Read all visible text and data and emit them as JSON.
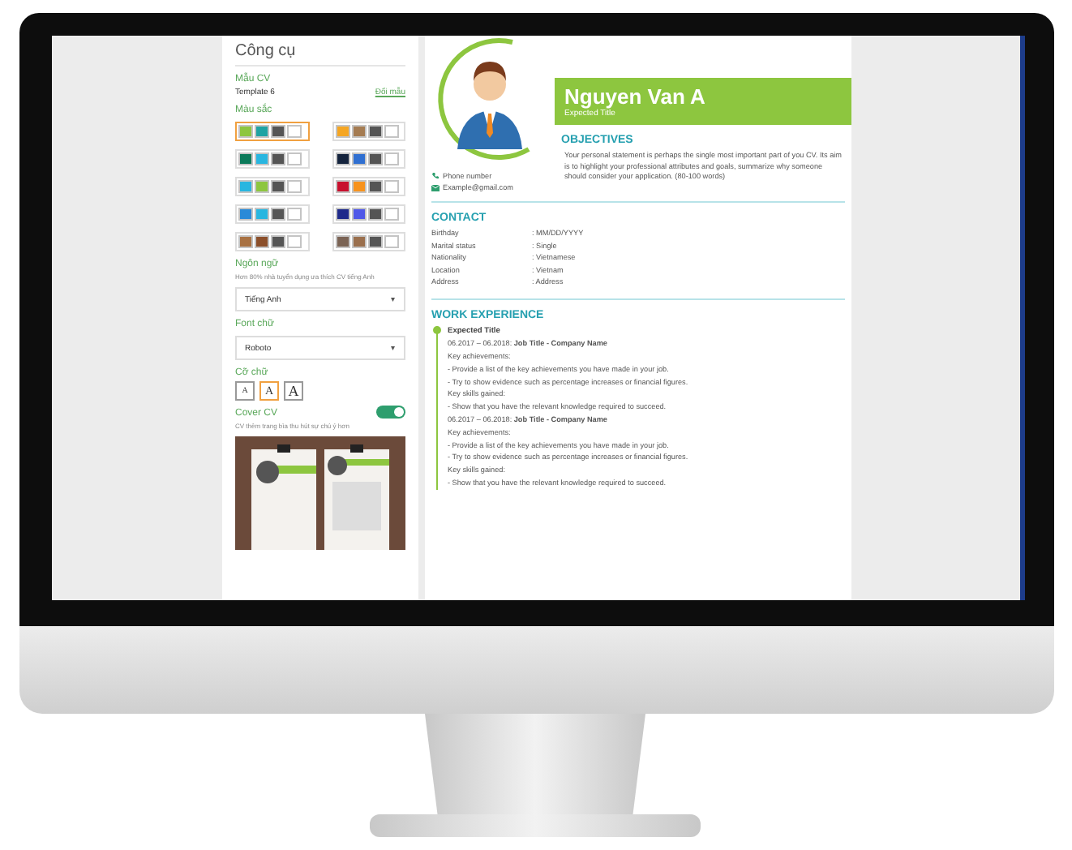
{
  "sidebar": {
    "title": "Công cụ",
    "template": {
      "label": "Mẫu CV",
      "value": "Template 6",
      "link": "Đổi mẫu"
    },
    "colors": {
      "label": "Màu sắc",
      "palettes": [
        {
          "selected": true,
          "swatches": [
            {
              "color": "#8dc63f"
            },
            {
              "color": "#1fa3a3"
            },
            {
              "color": "#555555"
            },
            {
              "color": "#ffffff"
            }
          ]
        },
        {
          "selected": false,
          "swatches": [
            {
              "color": "#f5a623"
            },
            {
              "color": "#a57c52"
            },
            {
              "color": "#555555"
            },
            {
              "color": "#ffffff"
            }
          ]
        },
        {
          "selected": false,
          "swatches": [
            {
              "color": "#0b7a5a"
            },
            {
              "color": "#29b6e0"
            },
            {
              "color": "#555555"
            },
            {
              "color": "#ffffff"
            }
          ]
        },
        {
          "selected": false,
          "swatches": [
            {
              "color": "#14233d"
            },
            {
              "color": "#2f6fd1"
            },
            {
              "color": "#555555"
            },
            {
              "color": "#ffffff"
            }
          ]
        },
        {
          "selected": false,
          "swatches": [
            {
              "color": "#29b6e0"
            },
            {
              "color": "#8dc63f"
            },
            {
              "color": "#555555"
            },
            {
              "color": "#ffffff"
            }
          ]
        },
        {
          "selected": false,
          "swatches": [
            {
              "color": "#c8102e"
            },
            {
              "color": "#f7931e"
            },
            {
              "color": "#555555"
            },
            {
              "color": "#ffffff"
            }
          ]
        },
        {
          "selected": false,
          "swatches": [
            {
              "color": "#2a8ad8"
            },
            {
              "color": "#29b6e0"
            },
            {
              "color": "#555555"
            },
            {
              "color": "#ffffff"
            }
          ]
        },
        {
          "selected": false,
          "swatches": [
            {
              "color": "#1f2a8a"
            },
            {
              "color": "#4f58e8"
            },
            {
              "color": "#555555"
            },
            {
              "color": "#ffffff"
            }
          ]
        },
        {
          "selected": false,
          "swatches": [
            {
              "color": "#a87142"
            },
            {
              "color": "#8b4f2a"
            },
            {
              "color": "#555555"
            },
            {
              "color": "#ffffff"
            }
          ]
        },
        {
          "selected": false,
          "swatches": [
            {
              "color": "#7a6354"
            },
            {
              "color": "#9a6f4d"
            },
            {
              "color": "#555555"
            },
            {
              "color": "#ffffff"
            }
          ]
        }
      ]
    },
    "language": {
      "label": "Ngôn ngữ",
      "hint": "Hơn 80% nhà tuyển dụng ưa thích CV tiếng Anh",
      "value": "Tiếng Anh",
      "caret": "▾"
    },
    "font": {
      "label": "Font chữ",
      "value": "Roboto",
      "caret": "▾"
    },
    "font_size": {
      "label": "Cỡ chữ",
      "options": [
        {
          "text": "A",
          "selected": false
        },
        {
          "text": "A",
          "selected": true
        },
        {
          "text": "A",
          "selected": false
        }
      ]
    },
    "cover": {
      "label": "Cover CV",
      "on": true,
      "hint": "CV thêm trang bìa thu hút sự chú ý hơn"
    }
  },
  "cv": {
    "name": "Nguyen Van A",
    "title": "Expected Title",
    "contacts": [
      {
        "kind": "phone",
        "text": "Phone number"
      },
      {
        "kind": "email",
        "text": "Example@gmail.com"
      }
    ],
    "objectives": {
      "heading": "OBJECTIVES",
      "text": "Your personal statement is perhaps the single most important part of you CV. Its aim is to highlight your professional attributes and goals, summarize why someone should consider your application. (80-100 words)"
    },
    "contact": {
      "heading": "CONTACT",
      "rows": [
        {
          "label": "Birthday",
          "value": ": MM/DD/YYYY"
        },
        {
          "label": "Marital status",
          "value": ": Single"
        },
        {
          "label": "Nationality",
          "value": ": Vietnamese"
        },
        {
          "label": "Location",
          "value": ": Vietnam"
        },
        {
          "label": "Address",
          "value": ": Address"
        }
      ]
    },
    "work": {
      "heading": "WORK EXPERIENCE",
      "title": "Expected Title",
      "entries": [
        {
          "period": "06.2017 – 06.2018: **Job Title - Company Name**",
          "lines": [
            "Key achievements:",
            "- Provide a list of the key achievements you have made in your job.",
            "- Try to show evidence such as percentage increases or financial figures.",
            "Key skills gained:",
            "- Show that you have the relevant knowledge required to succeed."
          ]
        },
        {
          "period": "06.2017 – 06.2018: **Job Title - Company Name**",
          "lines": [
            "Key achievements:",
            "- Provide a list of the key achievements you have made in your job.",
            "- Try to show evidence such as percentage increases or financial figures.",
            "Key skills gained:",
            "- Show that you have the relevant knowledge required to succeed."
          ]
        }
      ]
    }
  }
}
